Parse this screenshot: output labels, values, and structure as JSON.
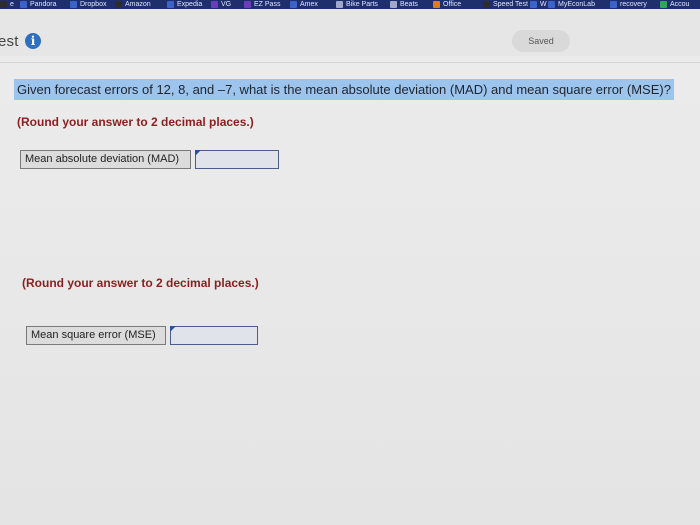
{
  "bookmarks": [
    {
      "label": "e",
      "icon": "generic-icon",
      "color": "#2d2d2d"
    },
    {
      "label": "Pandora",
      "icon": "pandora-icon",
      "color": "#3c63c8"
    },
    {
      "label": "Dropbox",
      "icon": "dropbox-icon",
      "color": "#3c63c8"
    },
    {
      "label": "Amazon",
      "icon": "amazon-icon",
      "color": "#2d2d2d"
    },
    {
      "label": "Expedia",
      "icon": "expedia-icon",
      "color": "#3c63c8"
    },
    {
      "label": "VG",
      "icon": "vg-icon",
      "color": "#6a3dbb"
    },
    {
      "label": "EZ Pass",
      "icon": "ezpass-icon",
      "color": "#6a3dbb"
    },
    {
      "label": "Amex",
      "icon": "amex-icon",
      "color": "#3c63c8"
    },
    {
      "label": "Bike Parts",
      "icon": "folder-icon",
      "color": "#9fa8c8"
    },
    {
      "label": "Beats",
      "icon": "folder-icon",
      "color": "#9fa8c8"
    },
    {
      "label": "Office",
      "icon": "office-icon",
      "color": "#e27b1e"
    },
    {
      "label": "Speed Test",
      "icon": "speedtest-icon",
      "color": "#2d2d2d"
    },
    {
      "label": "W",
      "icon": "w-icon",
      "color": "#3c63c8"
    },
    {
      "label": "MyEconLab",
      "icon": "myeconlab-icon",
      "color": "#3c63c8"
    },
    {
      "label": "recovery",
      "icon": "recovery-icon",
      "color": "#3c63c8"
    },
    {
      "label": "Accou",
      "icon": "account-icon",
      "color": "#2fa65a"
    }
  ],
  "header": {
    "test_label": "est",
    "info_icon_glyph": "i",
    "saved_label": "Saved"
  },
  "question": {
    "text": "Given forecast errors of 12, 8, and –7, what is the mean absolute deviation (MAD) and mean square error (MSE)?",
    "round_note_1": "(Round your answer to 2 decimal places.)",
    "round_note_2": "(Round your answer to 2 decimal places.)"
  },
  "answers": {
    "mad_label": "Mean absolute deviation (MAD)",
    "mad_value": "",
    "mse_label": "Mean square error (MSE)",
    "mse_value": ""
  },
  "colors": {
    "question_highlight": "#9dc4ec",
    "round_note": "#8b1f1f",
    "info_icon": "#2f6fc2"
  }
}
